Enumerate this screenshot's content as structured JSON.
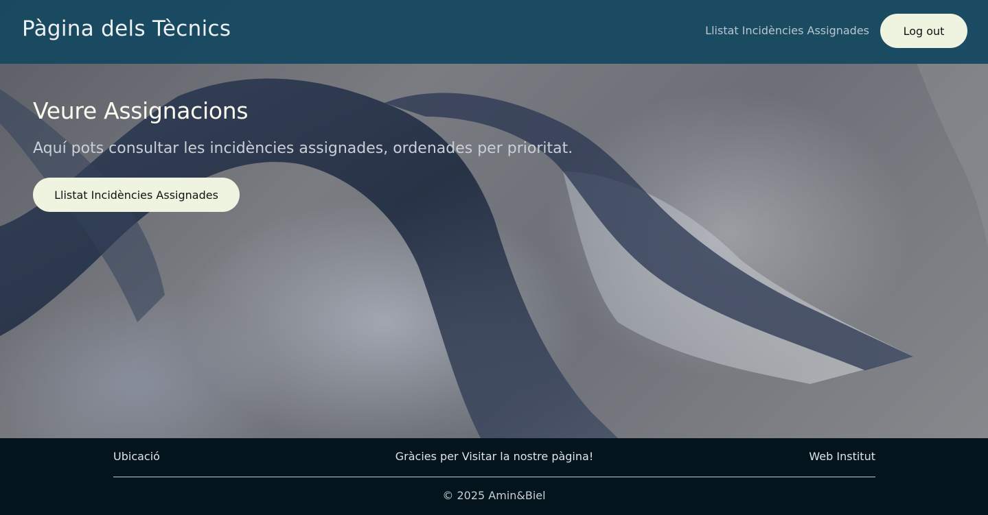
{
  "header": {
    "brand": "Pàgina dels Tècnics",
    "nav_link": "Llistat Incidències Assignades",
    "logout_label": "Log out"
  },
  "hero": {
    "title": "Veure Assignacions",
    "subtitle": "Aquí pots consultar les incidències assignades, ordenades per prioritat.",
    "button_label": "Llistat Incidències Assignades"
  },
  "footer": {
    "location_link": "Ubicació",
    "thanks": "Gràcies per Visitar la nostre pàgina!",
    "institute_link": "Web Institut",
    "copyright": "© 2025 Amin&Biel"
  },
  "colors": {
    "header_bg": "#144860",
    "button_bg": "#eef4e0",
    "footer_bg": "#03141c",
    "title_text": "#fbfbef"
  }
}
